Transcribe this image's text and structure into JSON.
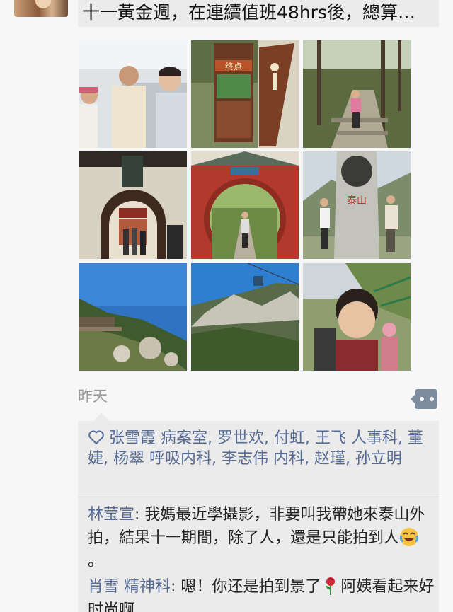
{
  "post": {
    "text": "十一黃金週，在連續值班48hrs後，總算…",
    "timestamp": "昨天"
  },
  "photos": [
    {
      "id": "photo-1",
      "sign_text": ""
    },
    {
      "id": "photo-2",
      "sign_text": "终点"
    },
    {
      "id": "photo-3",
      "sign_text": ""
    },
    {
      "id": "photo-4",
      "sign_text": ""
    },
    {
      "id": "photo-5",
      "sign_text": ""
    },
    {
      "id": "photo-6",
      "sign_text": "泰山"
    },
    {
      "id": "photo-7",
      "sign_text": ""
    },
    {
      "id": "photo-8",
      "sign_text": ""
    },
    {
      "id": "photo-9",
      "sign_text": ""
    }
  ],
  "likes": {
    "icon": "heart-outline-icon",
    "names_text": "张雪霞  病案室, 罗世欢, 付虹, 王飞 人事科, 董婕, 杨翠 呼吸内科, 李志伟  内科, 赵瑾, 孙立明"
  },
  "comments": [
    {
      "author": "林莹宣",
      "text": "我媽最近學攝影，非要叫我帶她來泰山外拍，結果十一期間，除了人，還是只能拍到人",
      "emoji": "laughing-crying-emoji",
      "suffix": "。"
    },
    {
      "author": "肖雪 精神科",
      "text": "嗯！你还是拍到景了",
      "emoji": "rose-emoji",
      "suffix": "阿姨看起来好时尚啊"
    }
  ],
  "colors": {
    "link_blue": "#576b95",
    "comment_button": "#7d8ba0",
    "background": "#f7f7f7",
    "panel": "#ebebeb"
  }
}
